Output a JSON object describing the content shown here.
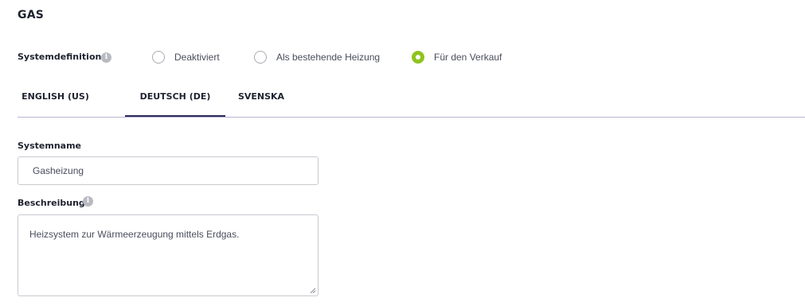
{
  "header": {
    "title": "GAS"
  },
  "system_definition": {
    "label": "Systemdefinition:",
    "info_icon": "info-icon",
    "options": [
      {
        "label": "Deaktiviert",
        "selected": false
      },
      {
        "label": "Als bestehende Heizung",
        "selected": false
      },
      {
        "label": "Für den Verkauf",
        "selected": true
      }
    ],
    "accent_color": "#8fc31f"
  },
  "tabs": [
    {
      "label": "ENGLISH (US)",
      "active": false
    },
    {
      "label": "DEUTSCH (DE)",
      "active": true
    },
    {
      "label": "SVENSKA",
      "active": false
    }
  ],
  "form": {
    "system_name": {
      "label": "Systemname",
      "value": "Gasheizung"
    },
    "description": {
      "label": "Beschreibung",
      "info_icon": "info-icon",
      "value": "Heizsystem zur Wärmeerzeugung mittels Erdgas."
    }
  }
}
